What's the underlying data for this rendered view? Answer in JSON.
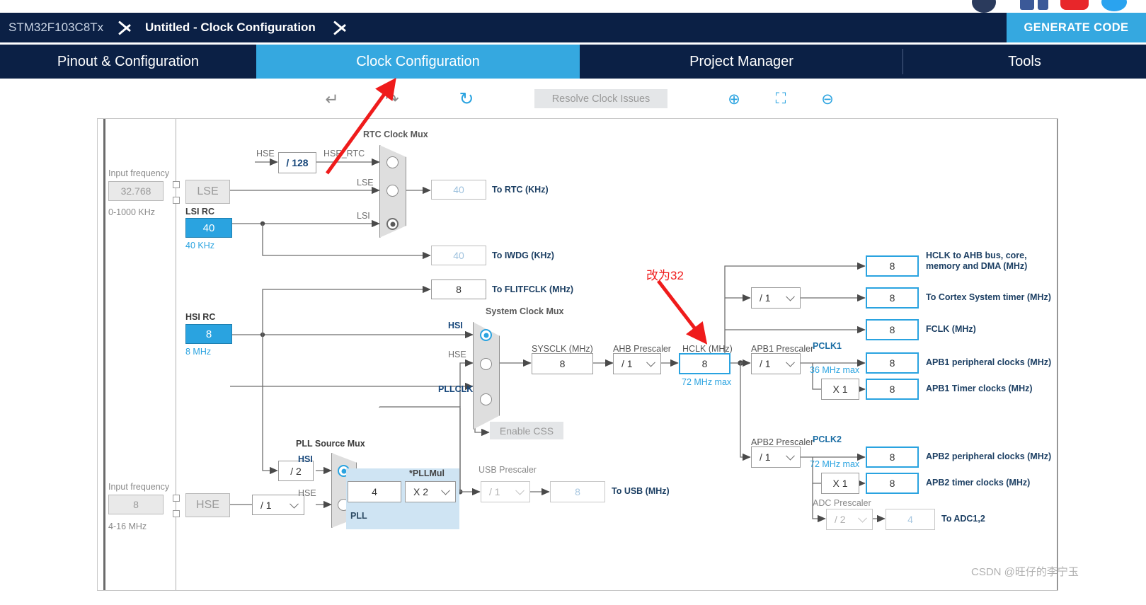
{
  "window": {
    "breadcrumb": {
      "device": "STM32F103C8Tx",
      "project": "Untitled - Clock Configuration"
    },
    "generate_code_label": "GENERATE CODE",
    "accent_blue": "#35a8e0",
    "header_navy": "#0b2045"
  },
  "tabs": [
    {
      "label": "Pinout & Configuration",
      "active": false
    },
    {
      "label": "Clock Configuration",
      "active": true
    },
    {
      "label": "Project Manager",
      "active": false
    },
    {
      "label": "Tools",
      "active": false
    }
  ],
  "toolbar": {
    "undo_icon": "undo-arrow-icon",
    "redo_icon": "redo-arrow-icon",
    "reset_icon": "reset-circular-arrow-icon",
    "resolve_label": "Resolve Clock Issues",
    "resolve_enabled": false,
    "zoom_in_icon": "zoom-in-icon",
    "fit_icon": "fit-to-screen-icon",
    "zoom_out_icon": "zoom-out-icon"
  },
  "annotations": [
    {
      "text": "改为32",
      "color": "#ef1b1b",
      "target": "HCLK field"
    }
  ],
  "watermark": "CSDN @旺仔的李宁玉",
  "clock_tree": {
    "lse_input": {
      "caption": "Input frequency",
      "value": "32.768",
      "range": "0-1000 KHz",
      "source_label": "LSE"
    },
    "hse_input": {
      "caption": "Input frequency",
      "value": "8",
      "range": "4-16 MHz",
      "source_label": "HSE"
    },
    "lsi_rc": {
      "title": "LSI RC",
      "value": "40",
      "unit": "40 KHz"
    },
    "hsi_rc": {
      "title": "HSI RC",
      "value": "8",
      "unit": "8 MHz"
    },
    "hse_div128": {
      "input_label": "HSE",
      "value": "/ 128",
      "output_label": "HSE_RTC"
    },
    "rtc_mux": {
      "title": "RTC Clock Mux",
      "inputs": [
        {
          "label": "HSE_RTC",
          "selected": false
        },
        {
          "label": "LSE",
          "selected": false
        },
        {
          "label": "LSI",
          "selected": true
        }
      ]
    },
    "to_rtc": {
      "value": "40",
      "label": "To RTC (KHz)"
    },
    "to_iwdg": {
      "value": "40",
      "label": "To IWDG (KHz)"
    },
    "to_flitfclk": {
      "value": "8",
      "label": "To FLITFCLK (MHz)"
    },
    "system_clock_mux": {
      "title": "System Clock Mux",
      "inputs": [
        {
          "label": "HSI",
          "selected": true
        },
        {
          "label": "HSE",
          "selected": false
        },
        {
          "label": "PLLCLK",
          "selected": false
        }
      ]
    },
    "enable_css": {
      "label": "Enable CSS",
      "enabled": false
    },
    "sysclk": {
      "label": "SYSCLK (MHz)",
      "value": "8"
    },
    "ahb_prescaler": {
      "label": "AHB Prescaler",
      "value": "/ 1"
    },
    "hclk": {
      "label": "HCLK (MHz)",
      "value": "8",
      "max": "72 MHz max",
      "highlighted": true
    },
    "pll_source_mux": {
      "title": "PLL Source Mux",
      "inputs": [
        {
          "label": "HSI",
          "selected": true
        },
        {
          "label": "HSE",
          "selected": false
        }
      ]
    },
    "hsi_div2": {
      "value": "/ 2"
    },
    "hse_pll_div": {
      "value": "/ 1"
    },
    "pll": {
      "panel_label": "PLL",
      "input_value": "4",
      "mul_label": "*PLLMul",
      "mul_value": "X 2"
    },
    "usb_prescaler": {
      "label": "USB Prescaler",
      "value": "/ 1"
    },
    "to_usb": {
      "value": "8",
      "label": "To USB (MHz)"
    },
    "outputs": [
      {
        "value": "8",
        "label": "HCLK to AHB bus, core, memory and DMA (MHz)"
      },
      {
        "value": "8",
        "label": "To Cortex System timer (MHz)"
      },
      {
        "value": "8",
        "label": "FCLK (MHz)"
      },
      {
        "value": "8",
        "label": "APB1 peripheral clocks (MHz)"
      },
      {
        "value": "8",
        "label": "APB1 Timer clocks (MHz)"
      },
      {
        "value": "8",
        "label": "APB2 peripheral clocks (MHz)"
      },
      {
        "value": "8",
        "label": "APB2 timer clocks (MHz)"
      }
    ],
    "cortex_prescaler": {
      "value": "/ 1"
    },
    "apb1": {
      "prescaler_label": "APB1 Prescaler",
      "prescaler_value": "/ 1",
      "pclk_label": "PCLK1",
      "max": "36 MHz max",
      "timer_mul": "X 1"
    },
    "apb2": {
      "prescaler_label": "APB2 Prescaler",
      "prescaler_value": "/ 1",
      "pclk_label": "PCLK2",
      "max": "72 MHz max",
      "timer_mul": "X 1"
    },
    "adc": {
      "prescaler_label": "ADC Prescaler",
      "prescaler_value": "/ 2",
      "value": "4",
      "label": "To ADC1,2"
    }
  }
}
